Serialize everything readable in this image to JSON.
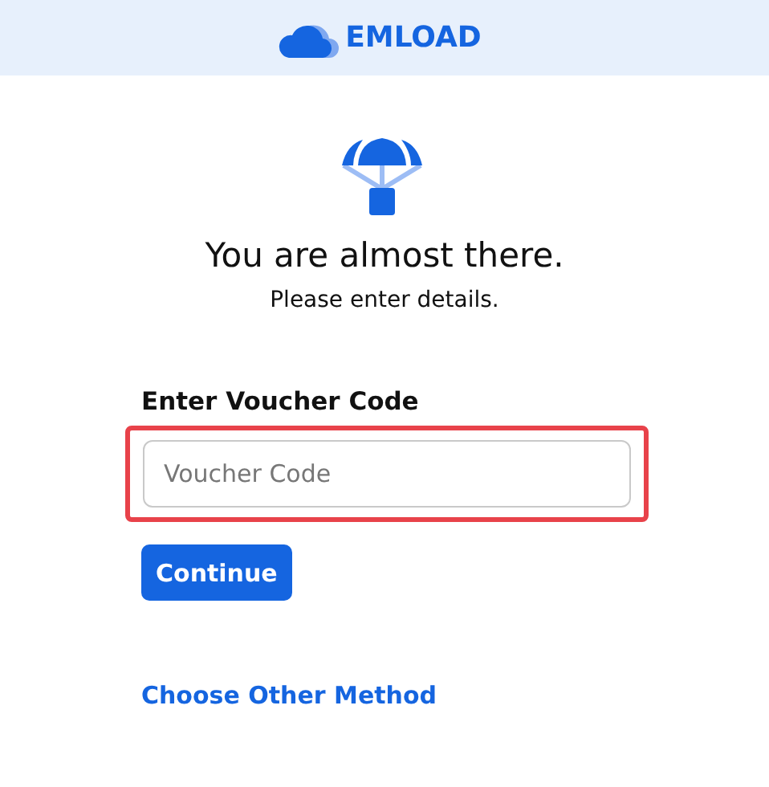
{
  "header": {
    "brand": "EMLOAD"
  },
  "heading": "You are almost there.",
  "subtitle": "Please enter details.",
  "voucher": {
    "label": "Enter Voucher Code",
    "placeholder": "Voucher Code",
    "highlighted": true
  },
  "buttons": [
    "Continue"
  ],
  "links": [
    "Choose Other Method"
  ]
}
